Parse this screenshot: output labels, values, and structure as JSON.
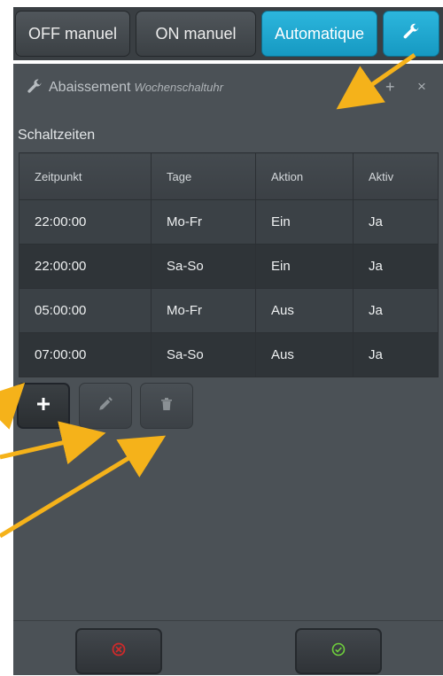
{
  "top_caption": "",
  "mode_buttons": {
    "off": "OFF manuel",
    "on": "ON manuel",
    "auto": "Automatique"
  },
  "panel": {
    "title": "Abaissement",
    "subtitle": "Wochenschaltuhr",
    "section": "Schaltzeiten"
  },
  "table": {
    "headers": [
      "Zeitpunkt",
      "Tage",
      "Aktion",
      "Aktiv"
    ],
    "rows": [
      [
        "22:00:00",
        "Mo-Fr",
        "Ein",
        "Ja"
      ],
      [
        "22:00:00",
        "Sa-So",
        "Ein",
        "Ja"
      ],
      [
        "05:00:00",
        "Mo-Fr",
        "Aus",
        "Ja"
      ],
      [
        "07:00:00",
        "Sa-So",
        "Aus",
        "Ja"
      ]
    ]
  },
  "icons": {
    "settings": "wrench-icon",
    "add": "plus-icon",
    "edit": "pencil-icon",
    "delete": "trash-icon",
    "cancel": "cancel-circle-icon",
    "confirm": "check-circle-icon"
  },
  "colors": {
    "active_mode": "#1ea6cf",
    "annotation_arrow": "#f5b21a",
    "cancel_icon": "#d02a2a",
    "confirm_icon": "#6fcf3c"
  }
}
